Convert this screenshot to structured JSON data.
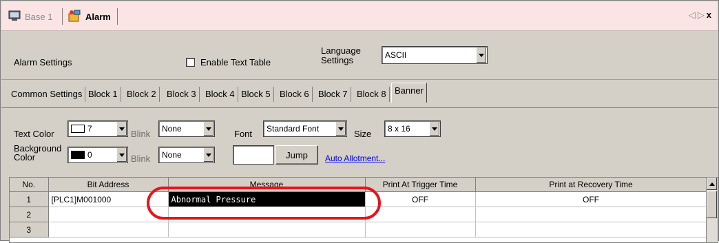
{
  "tabs": [
    {
      "label": "Base 1",
      "active": false,
      "icon": "screen-icon"
    },
    {
      "label": "Alarm",
      "active": true,
      "icon": "alarm-icon"
    }
  ],
  "nav": {
    "prev": "◁",
    "next": "▷",
    "close": "x"
  },
  "settings": {
    "title": "Alarm Settings",
    "enable_text_table": "Enable Text Table",
    "enable_text_table_checked": false,
    "language_label_line1": "Language",
    "language_label_line2": "Settings",
    "language_value": "ASCII"
  },
  "block_tabs": [
    "Common Settings",
    "Block 1",
    "Block 2",
    "Block 3",
    "Block 4",
    "Block 5",
    "Block 6",
    "Block 7",
    "Block 8",
    "Banner"
  ],
  "active_block_tab": "Banner",
  "text_options": {
    "text_color_label": "Text Color",
    "text_color_value": "7",
    "blink_label": "Blink",
    "blink_value": "None",
    "font_label": "Font",
    "font_value": "Standard Font",
    "size_label": "Size",
    "size_value": "8 x 16",
    "bg_color_label_line1": "Background",
    "bg_color_label_line2": "Color",
    "bg_color_value": "0",
    "bg_blink_label": "Blink",
    "bg_blink_value": "None",
    "jump_input": "",
    "jump_button": "Jump",
    "auto_allotment": "Auto Allotment..."
  },
  "grid": {
    "columns": [
      "No.",
      "Bit Address",
      "Message",
      "Print At Trigger Time",
      "Print at Recovery Time"
    ],
    "rows": [
      {
        "no": "1",
        "address": "[PLC1]M001000",
        "message": "Abnormal Pressure",
        "trigger": "OFF",
        "recovery": "OFF"
      },
      {
        "no": "2",
        "address": "",
        "message": "",
        "trigger": "",
        "recovery": ""
      },
      {
        "no": "3",
        "address": "",
        "message": "",
        "trigger": "",
        "recovery": ""
      }
    ]
  },
  "colors": {
    "tab_bg": "#fbe4e4",
    "panel_bg": "#d4d0c8",
    "annotation": "#e8141b",
    "link": "#0000ee"
  }
}
